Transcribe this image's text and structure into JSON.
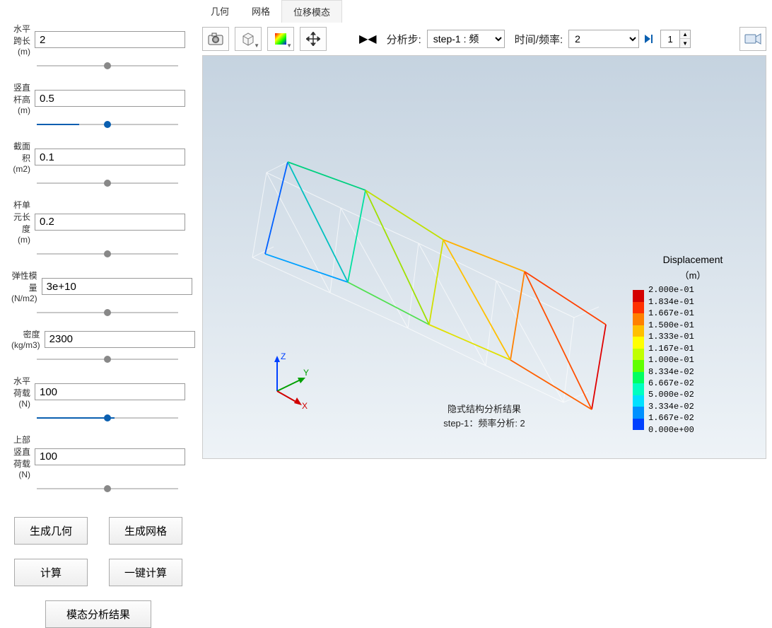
{
  "sidebar": {
    "params": [
      {
        "label": "水平跨长(m)",
        "value": "2",
        "active": false,
        "p": "5%"
      },
      {
        "label": "竖直杆高(m)",
        "value": "0.5",
        "active": true,
        "p": "30%"
      },
      {
        "label": "截面积(m2)",
        "value": "0.1",
        "active": false,
        "p": "5%"
      },
      {
        "label": "杆单元长度(m)",
        "value": "0.2",
        "active": false,
        "p": "5%"
      },
      {
        "label": "弹性模量(N/m2)",
        "value": "3e+10",
        "active": false,
        "p": "5%"
      },
      {
        "label": "密度(kg/m3)",
        "value": "2300",
        "active": false,
        "p": "5%"
      },
      {
        "label": "水平荷载(N)",
        "value": "100",
        "active": true,
        "p": "55%"
      },
      {
        "label": "上部竖直荷载(N)",
        "value": "100",
        "active": false,
        "p": "3%"
      }
    ],
    "buttons": {
      "gen_geom": "生成几何",
      "gen_mesh": "生成网格",
      "compute": "计算",
      "one_click": "一键计算",
      "modal_result": "模态分析结果"
    }
  },
  "tabs": {
    "items": [
      "几何",
      "网格",
      "位移模态"
    ],
    "active": 2
  },
  "toolbar": {
    "step_label": "分析步:",
    "step_value": "step-1 : 频",
    "time_label": "时间/频率:",
    "time_value": "2",
    "spinner": "1"
  },
  "viewport": {
    "caption_line1": "隐式结构分析结果",
    "caption_line2": "step-1：频率分析: 2",
    "axis": {
      "x": "X",
      "y": "Y",
      "z": "Z"
    }
  },
  "legend": {
    "title": "Displacement",
    "unit": "（m）",
    "values": [
      "2.000e-01",
      "1.834e-01",
      "1.667e-01",
      "1.500e-01",
      "1.333e-01",
      "1.167e-01",
      "1.000e-01",
      "8.334e-02",
      "6.667e-02",
      "5.000e-02",
      "3.334e-02",
      "1.667e-02",
      "0.000e+00"
    ],
    "colors": [
      "#d40000",
      "#ff3000",
      "#ff8000",
      "#ffc000",
      "#ffff00",
      "#c0ff00",
      "#60ff00",
      "#00ff60",
      "#00ffc0",
      "#00e0ff",
      "#0090ff",
      "#0040ff"
    ]
  },
  "chart_data": {
    "type": "colorscale",
    "title": "Displacement (m)",
    "range": [
      0.0,
      0.2
    ],
    "ticks": [
      0.2,
      0.1834,
      0.1667,
      0.15,
      0.1333,
      0.1167,
      0.1,
      0.08334,
      0.06667,
      0.05,
      0.03334,
      0.01667,
      0.0
    ]
  }
}
